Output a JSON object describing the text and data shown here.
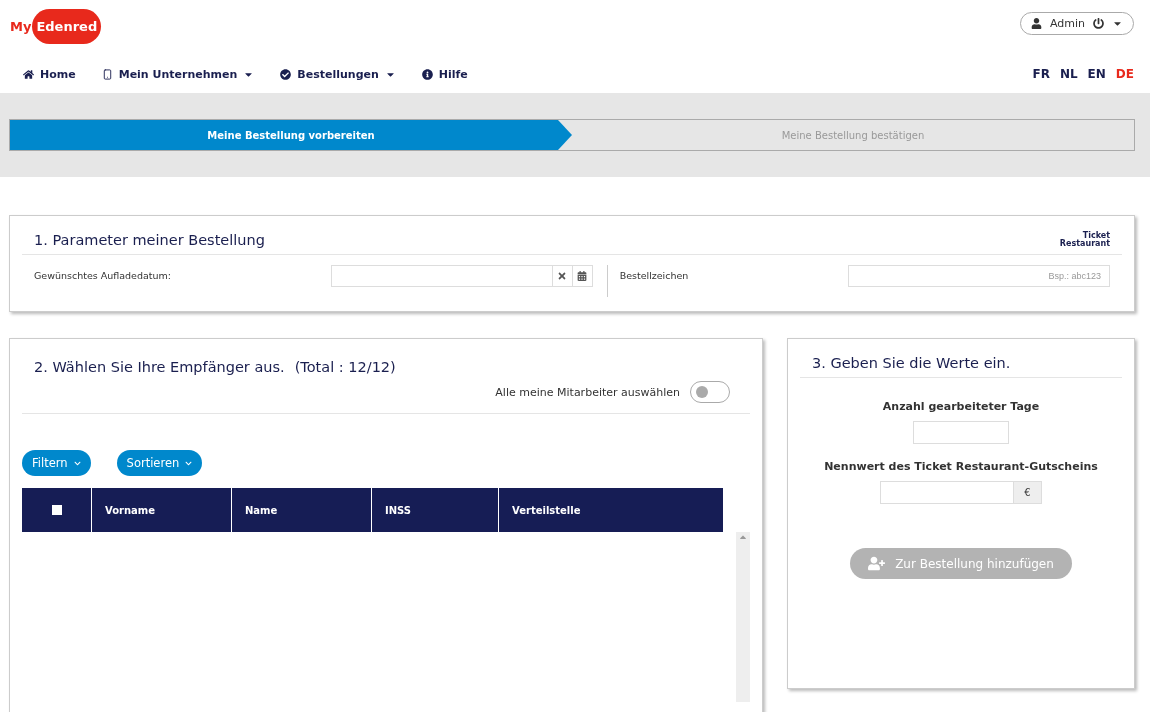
{
  "logo": {
    "prefix": "My",
    "brand": "Edenred"
  },
  "user_menu": {
    "label": "Admin"
  },
  "nav": [
    {
      "kind": "home",
      "label": "Home",
      "dropdown": false
    },
    {
      "kind": "company",
      "label": "Mein Unternehmen",
      "dropdown": true
    },
    {
      "kind": "orders",
      "label": "Bestellungen",
      "dropdown": true
    },
    {
      "kind": "help",
      "label": "Hilfe",
      "dropdown": false
    }
  ],
  "languages": [
    {
      "label": "FR",
      "selected": false
    },
    {
      "label": "NL",
      "selected": false
    },
    {
      "label": "EN",
      "selected": false
    },
    {
      "label": "DE",
      "selected": true
    }
  ],
  "steps": [
    {
      "label": "Meine Bestellung vorbereiten",
      "selected": true
    },
    {
      "label": "Meine Bestellung bestätigen",
      "selected": false
    }
  ],
  "parameters": {
    "title": "1. Parameter meiner Bestellung",
    "brand_line1": "Ticket",
    "brand_line2": "Restaurant",
    "date_label": "Gewünschtes Aufladedatum:",
    "reference_label": "Bestellzeichen",
    "reference_placeholder": "Bsp.: abc123"
  },
  "recipients": {
    "title": "2. Wählen Sie Ihre Empfänger aus.",
    "total": "(Total : 12/12)",
    "select_all_label": "Alle meine Mitarbeiter auswählen",
    "select_all_on": false,
    "buttons": [
      "Filtern",
      "Sortieren"
    ],
    "header_checked": false,
    "columns": [
      "Vorname",
      "Name",
      "INSS",
      "Verteilstelle"
    ]
  },
  "values": {
    "title": "3. Geben Sie die Werte ein.",
    "days_label": "Anzahl gearbeiteter Tage",
    "value_label": "Nennwert des Ticket Restaurant-Gutscheins",
    "currency": "€",
    "add_button": "Zur Bestellung hinzufügen",
    "add_disabled": true
  }
}
